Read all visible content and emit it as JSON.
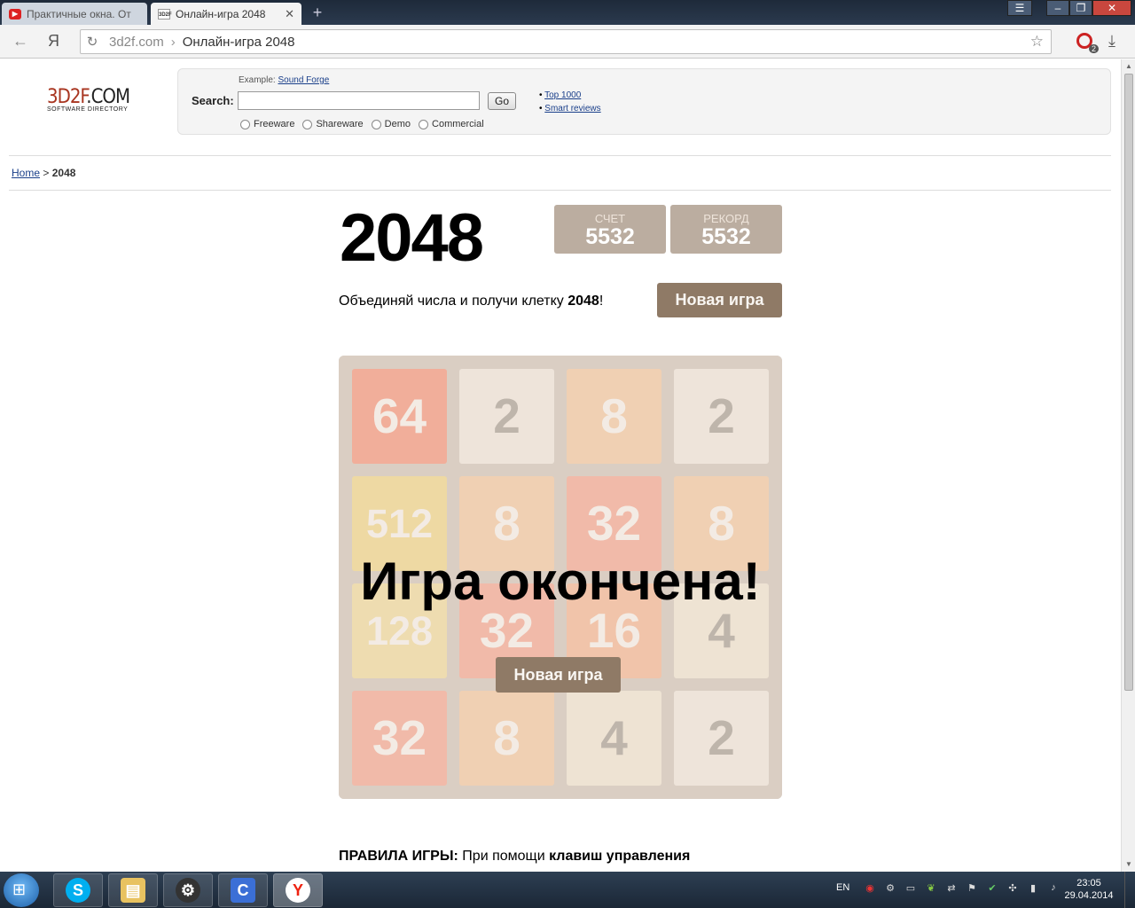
{
  "browser": {
    "tabs": [
      {
        "label": "Практичные окна. От",
        "active": false
      },
      {
        "label": "Онлайн-игра 2048",
        "active": true
      }
    ],
    "address": {
      "host": "3d2f.com",
      "separator": "›",
      "title": "Онлайн-игра 2048"
    },
    "yandex_glyph": "Я",
    "opera_badge": "2"
  },
  "site": {
    "logo_main": "3D2F",
    "logo_suffix": ".COM",
    "logo_sub": "SOFTWARE DIRECTORY",
    "example_label": "Example:",
    "example_link": "Sound Forge",
    "search_label": "Search:",
    "search_value": "",
    "go_label": "Go",
    "radios": [
      "Freeware",
      "Shareware",
      "Demo",
      "Commercial"
    ],
    "links": [
      "Top 1000",
      "Smart reviews"
    ],
    "breadcrumb": {
      "home": "Home",
      "sep": ">",
      "current": "2048"
    }
  },
  "game": {
    "title": "2048",
    "score_label": "СЧЕТ",
    "score": "5532",
    "best_label": "РЕКОРД",
    "best": "5532",
    "intro_text": "Объединяй числа и получи клетку ",
    "intro_bold": "2048",
    "intro_end": "!",
    "new_game_label": "Новая игра",
    "game_over_text": "Игра окончена!",
    "grid": [
      [
        64,
        2,
        8,
        2
      ],
      [
        512,
        8,
        32,
        8
      ],
      [
        128,
        32,
        16,
        4
      ],
      [
        32,
        8,
        4,
        2
      ]
    ],
    "rules_bold": "ПРАВИЛА ИГРЫ:",
    "rules_text": " При помощи ",
    "rules_bold2": "клавиш управления"
  },
  "taskbar": {
    "apps": [
      "skype-icon",
      "explorer-icon",
      "steam-icon",
      "cc-icon",
      "yandex-browser-icon"
    ],
    "lang": "EN",
    "time": "23:05",
    "date": "29.04.2014"
  },
  "colors": {
    "tile_2": "#eee4da",
    "tile_4": "#ede0c8",
    "tile_8": "#f2b179",
    "tile_16": "#f59563",
    "tile_32": "#f67c5f",
    "tile_64": "#f65e3b",
    "tile_128": "#edcf72",
    "tile_512": "#edc850"
  }
}
